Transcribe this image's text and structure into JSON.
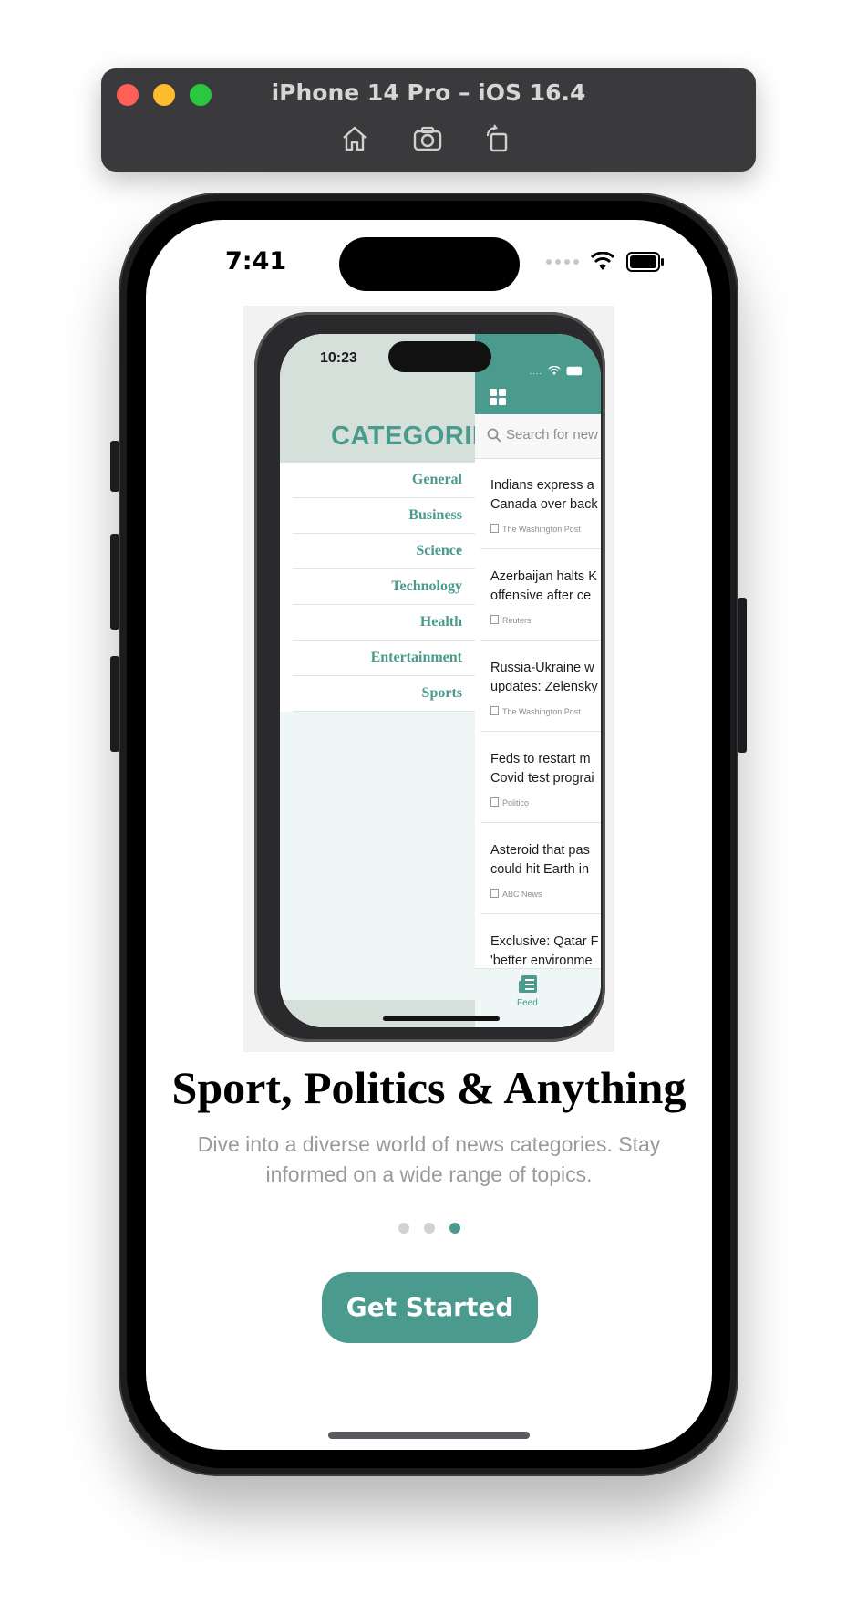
{
  "simulator": {
    "title": "iPhone 14 Pro – iOS 16.4",
    "toolbar_icons": [
      "home-icon",
      "screenshot-icon",
      "rotate-icon"
    ]
  },
  "status_bar": {
    "time": "7:41"
  },
  "embedded_screenshot": {
    "status_time": "10:23",
    "categories_title": "CATEGORIES",
    "categories": [
      "General",
      "Business",
      "Science",
      "Technology",
      "Health",
      "Entertainment",
      "Sports"
    ],
    "search_placeholder": "Search for new",
    "news": [
      {
        "title": "Indians express a\nCanada over back",
        "source": "The Washington Post"
      },
      {
        "title": "Azerbaijan halts K\noffensive after ce",
        "source": "Reuters"
      },
      {
        "title": "Russia-Ukraine w\nupdates: Zelensky",
        "source": "The Washington Post"
      },
      {
        "title": "Feds to restart m\nCovid test prograi",
        "source": "Politico"
      },
      {
        "title": "Asteroid that pas\ncould hit Earth in",
        "source": "ABC News"
      },
      {
        "title": "Exclusive: Qatar F\n'better environme",
        "source": ""
      }
    ],
    "tab_label": "Feed"
  },
  "onboarding": {
    "headline": "Sport, Politics & Anything",
    "subtitle": "Dive into a diverse world of news categories. Stay informed on a wide range of topics.",
    "page_count": 3,
    "active_page": 3,
    "cta_label": "Get Started"
  },
  "colors": {
    "accent": "#4a9a8d",
    "simulator_bar": "#3a3a3c"
  }
}
